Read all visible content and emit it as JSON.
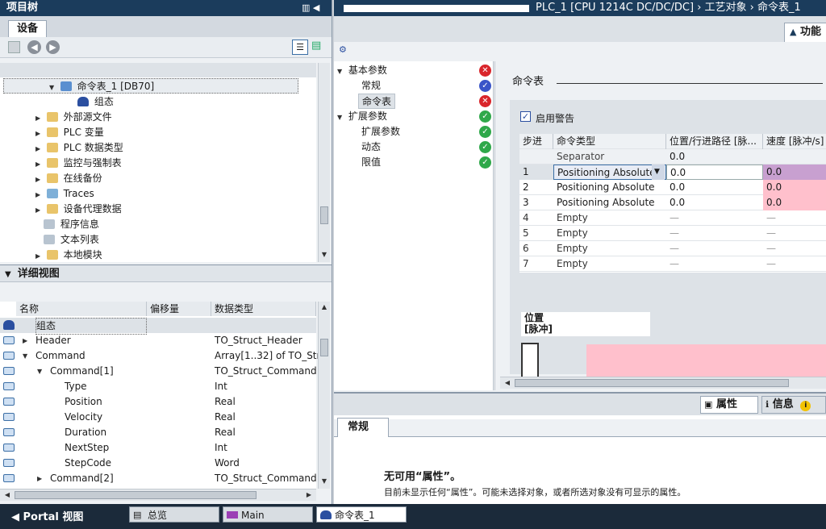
{
  "colors": {
    "titlebar": "#1b3c5c",
    "error": "#d9252b",
    "ok": "#2fa84a",
    "info": "#3a55c8",
    "pink": "#ffc0cc",
    "purple": "#c8a0d0"
  },
  "project_tree": {
    "title": "项目树",
    "tab": "设备",
    "items": [
      {
        "label": "命令表_1 [DB70]",
        "icon": "db-icon"
      },
      {
        "label": "组态",
        "icon": "config-icon"
      },
      {
        "label": "外部源文件",
        "icon": "folder-icon"
      },
      {
        "label": "PLC 变量",
        "icon": "folder-icon"
      },
      {
        "label": "PLC 数据类型",
        "icon": "folder-icon"
      },
      {
        "label": "监控与强制表",
        "icon": "folder-icon"
      },
      {
        "label": "在线备份",
        "icon": "folder-icon"
      },
      {
        "label": "Traces",
        "icon": "trace-icon"
      },
      {
        "label": "设备代理数据",
        "icon": "folder-icon"
      },
      {
        "label": "程序信息",
        "icon": "info-icon"
      },
      {
        "label": "文本列表",
        "icon": "list-icon"
      },
      {
        "label": "本地模块",
        "icon": "folder-icon"
      }
    ]
  },
  "detail_view": {
    "title": "详细视图",
    "columns": [
      "名称",
      "偏移量",
      "数据类型"
    ],
    "rows": [
      {
        "name": "组态",
        "offset": "",
        "type": ""
      },
      {
        "name": "Header",
        "offset": "",
        "type": "TO_Struct_Header"
      },
      {
        "name": "Command",
        "offset": "",
        "type": "Array[1..32] of TO_Str..."
      },
      {
        "name": "Command[1]",
        "offset": "",
        "type": "TO_Struct_Command"
      },
      {
        "name": "Type",
        "offset": "",
        "type": "Int"
      },
      {
        "name": "Position",
        "offset": "",
        "type": "Real"
      },
      {
        "name": "Velocity",
        "offset": "",
        "type": "Real"
      },
      {
        "name": "Duration",
        "offset": "",
        "type": "Real"
      },
      {
        "name": "NextStep",
        "offset": "",
        "type": "Int"
      },
      {
        "name": "StepCode",
        "offset": "",
        "type": "Word"
      },
      {
        "name": "Command[2]",
        "offset": "",
        "type": "TO_Struct_Command"
      }
    ]
  },
  "editor": {
    "breadcrumb": "PLC_1 [CPU 1214C DC/DC/DC]  ›  工艺对象  ›  命令表_1",
    "function_tab": "功能",
    "nav": [
      {
        "label": "基本参数",
        "status": "error"
      },
      {
        "label": "常规",
        "status": "info"
      },
      {
        "label": "命令表",
        "status": "error"
      },
      {
        "label": "扩展参数",
        "status": "ok"
      },
      {
        "label": "扩展参数",
        "status": "ok"
      },
      {
        "label": "动态",
        "status": "ok"
      },
      {
        "label": "限值",
        "status": "ok"
      }
    ],
    "section_title": "命令表",
    "enable_warning": "启用警告",
    "table_headers": [
      "步进",
      "命令类型",
      "位置/行进路径 [脉...",
      "速度 [脉冲/s]"
    ],
    "table_rows": [
      {
        "step": "",
        "type": "Separator",
        "pos": "0.0",
        "vel": ""
      },
      {
        "step": "1",
        "type": "Positioning Absolute",
        "pos": "0.0",
        "vel": "0.0"
      },
      {
        "step": "2",
        "type": "Positioning Absolute",
        "pos": "0.0",
        "vel": "0.0"
      },
      {
        "step": "3",
        "type": "Positioning Absolute",
        "pos": "0.0",
        "vel": "0.0"
      },
      {
        "step": "4",
        "type": "Empty",
        "pos": "—",
        "vel": "—"
      },
      {
        "step": "5",
        "type": "Empty",
        "pos": "—",
        "vel": "—"
      },
      {
        "step": "6",
        "type": "Empty",
        "pos": "—",
        "vel": "—"
      },
      {
        "step": "7",
        "type": "Empty",
        "pos": "—",
        "vel": "—"
      }
    ],
    "chart_label_1": "位置",
    "chart_label_2": "[脉冲]"
  },
  "inspector": {
    "tabs": [
      "属性",
      "信息"
    ],
    "sub_tab": "常规",
    "heading": "无可用“属性”。",
    "message": "目前未显示任何“属性”。可能未选择对象，或者所选对象没有可显示的属性。"
  },
  "taskbar": {
    "portal": "Portal 视图",
    "tabs": [
      "总览",
      "Main",
      "命令表_1"
    ]
  }
}
